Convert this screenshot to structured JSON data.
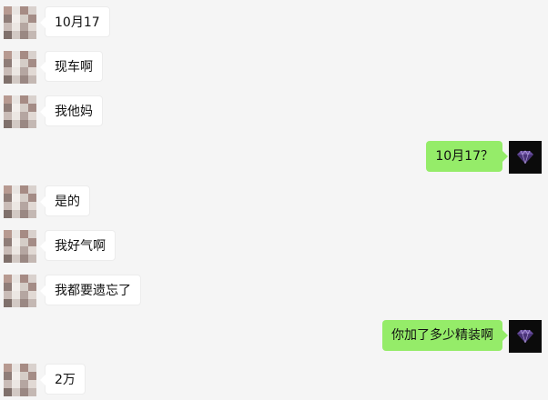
{
  "messages": [
    {
      "side": "in",
      "text": "10月17"
    },
    {
      "side": "in",
      "text": "现车啊"
    },
    {
      "side": "in",
      "text": "我他妈"
    },
    {
      "side": "out",
      "text": "10月17？"
    },
    {
      "side": "in",
      "text": "是的"
    },
    {
      "side": "in",
      "text": "我好气啊"
    },
    {
      "side": "in",
      "text": "我都要遗忘了"
    },
    {
      "side": "out",
      "text": "你加了多少精装啊"
    },
    {
      "side": "in",
      "text": "2万"
    }
  ],
  "colors": {
    "background": "#f5f5f5",
    "incoming_bubble": "#ffffff",
    "outgoing_bubble": "#95ec69",
    "outgoing_avatar_bg": "#0b0b0b",
    "diamond": "#6a4fa0"
  },
  "icons": {
    "contact_avatar": "pixelated-avatar",
    "self_avatar": "diamond-icon"
  }
}
